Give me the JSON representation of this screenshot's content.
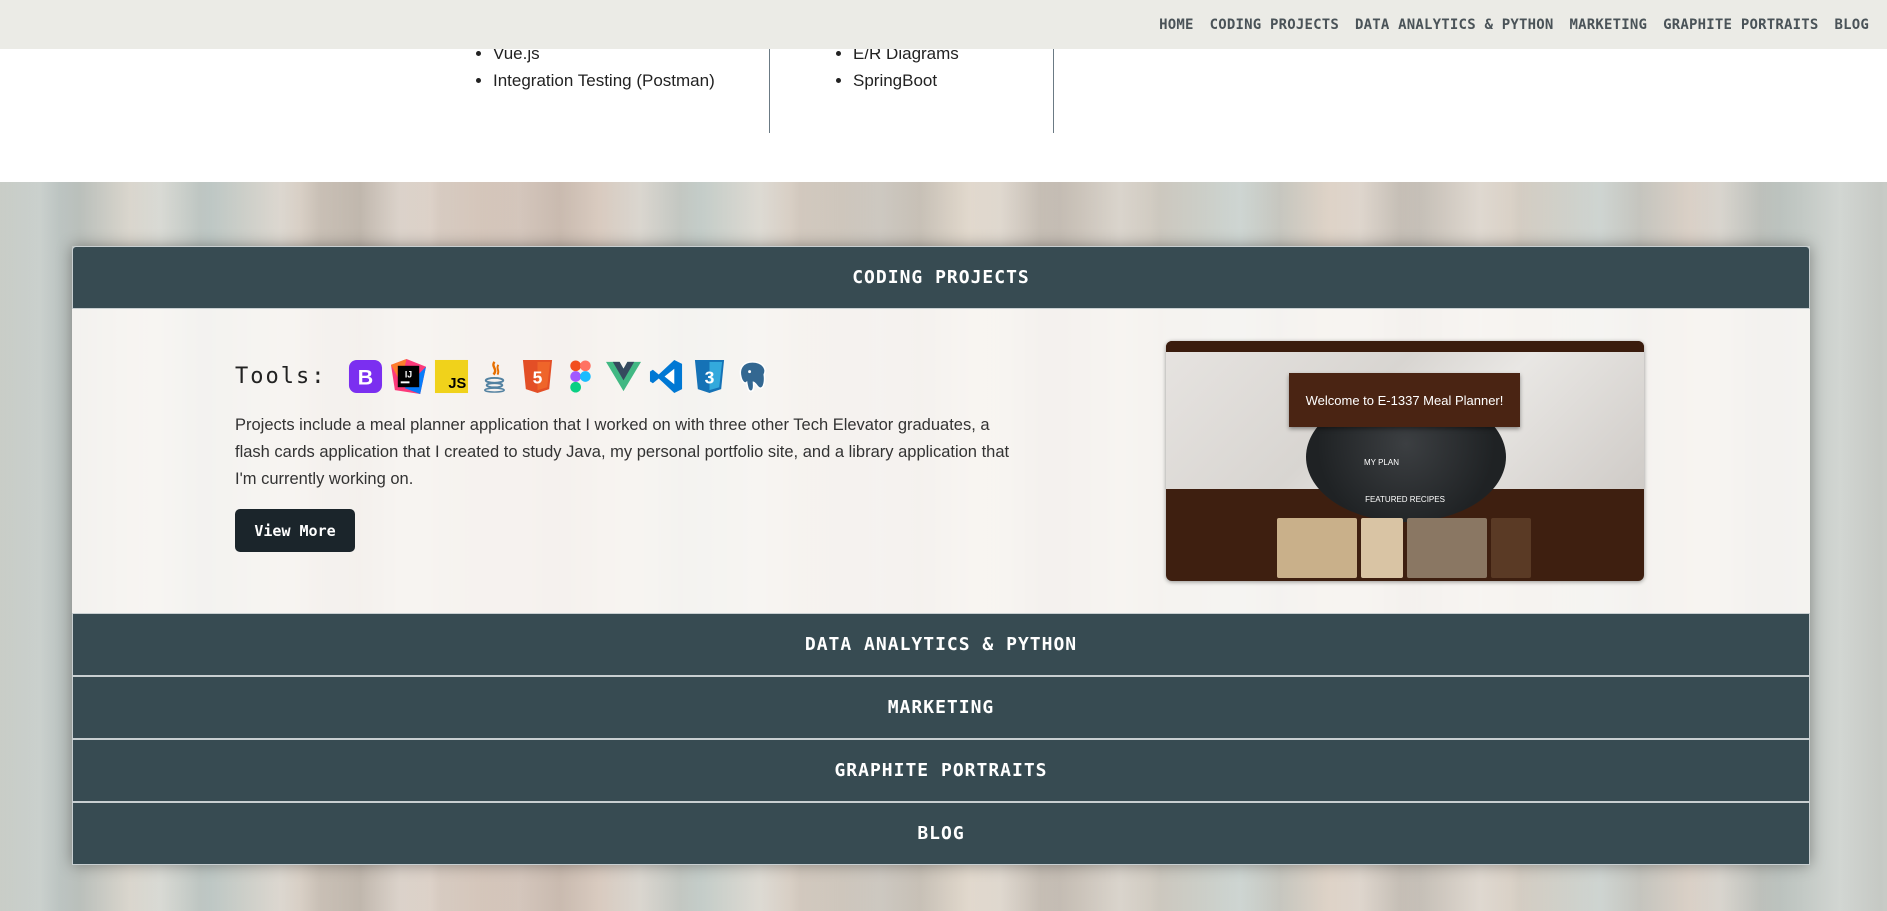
{
  "nav": {
    "links": [
      "HOME",
      "CODING PROJECTS",
      "DATA ANALYTICS & PYTHON",
      "MARKETING",
      "GRAPHITE PORTRAITS",
      "BLOG"
    ]
  },
  "skills": {
    "col_a": [
      "Vue.js",
      "Integration Testing (Postman)"
    ],
    "col_b": [
      "E/R Diagrams",
      "SpringBoot"
    ]
  },
  "accordion": {
    "open_section": {
      "title": "CODING PROJECTS",
      "tools_label": "Tools:",
      "tools": [
        "bootstrap-icon",
        "intellij-icon",
        "javascript-icon",
        "java-icon",
        "html5-icon",
        "figma-icon",
        "vue-icon",
        "vscode-icon",
        "css3-icon",
        "postgresql-icon"
      ],
      "description": "Projects include a meal planner application that I worked on with three other Tech Elevator graduates, a flash cards application that I created to study Java, my personal portfolio site, and a library application that I'm currently working on.",
      "button_label": "View More",
      "preview": {
        "title": "Welcome to E-1337 Meal Planner!",
        "my_plan": "MY PLAN",
        "featured": "FEATURED RECIPES"
      }
    },
    "collapsed_sections": [
      "DATA ANALYTICS & PYTHON",
      "MARKETING",
      "GRAPHITE PORTRAITS",
      "BLOG"
    ]
  },
  "colors": {
    "nav_bg": "#ebebe6",
    "accordion_header": "#374b52",
    "button_bg": "#1b252b"
  }
}
